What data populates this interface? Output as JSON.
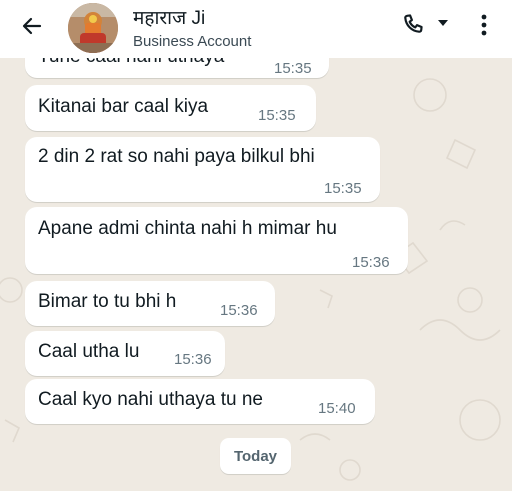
{
  "header": {
    "contact_name": "महाराज Ji",
    "account_type": "Business Account",
    "back_icon": "arrow-left-icon",
    "call_icon": "phone-icon",
    "dropdown_icon": "caret-down-icon",
    "menu_icon": "more-vertical-icon"
  },
  "messages": [
    {
      "text": "Tune caal nahi uthaya",
      "time": "15:35"
    },
    {
      "text": "Kitanai bar caal kiya",
      "time": "15:35"
    },
    {
      "text": "2 din 2 rat so nahi paya bilkul bhi",
      "time": "15:35"
    },
    {
      "text": "Apane admi chinta nahi h mimar hu",
      "time": "15:36"
    },
    {
      "text": "Bimar to tu bhi h",
      "time": "15:36"
    },
    {
      "text": "Caal utha lu",
      "time": "15:36"
    },
    {
      "text": "Caal kyo nahi uthaya tu ne",
      "time": "15:40"
    }
  ],
  "date_divider": "Today",
  "colors": {
    "chat_background": "#efeae2",
    "bubble": "#ffffff",
    "timestamp": "#667781",
    "header_icon": "#111b21"
  }
}
